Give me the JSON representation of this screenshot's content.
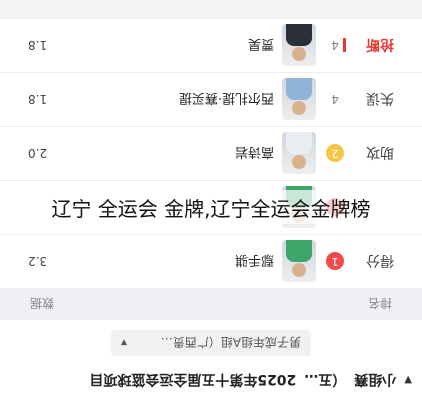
{
  "header": {
    "tab_left": "小组赛",
    "tab_middle": "（五…",
    "tab_title": "2025年第十五届全运会篮球项目",
    "dots": "…"
  },
  "filter": {
    "label": "男子成年组A组（广西贵…"
  },
  "table_head": {
    "rank": "排名",
    "data": "数据"
  },
  "rows": [
    {
      "category": "得分",
      "rank": "1",
      "name": "鄢手骐",
      "stat": "3.2"
    },
    {
      "category": "",
      "rank": "",
      "name": "",
      "stat": ""
    },
    {
      "category": "助攻",
      "rank": "2",
      "name": "高诗岩",
      "stat": "2.0"
    },
    {
      "category": "失误",
      "rank": "4",
      "name": "西尔扎提·赛买提",
      "stat": "1.8"
    },
    {
      "category": "抢断",
      "rank": "4",
      "name": "贾昊",
      "stat": "1.8"
    }
  ],
  "overlay_text": "辽宁 全运会 金牌,辽宁全运会金牌榜",
  "colors": {
    "accent": "#e53935",
    "gold": "#f6c646",
    "jersey_green": "#3fa66b",
    "jersey_white": "#e9edf1",
    "suit": "#2b2f3a"
  }
}
